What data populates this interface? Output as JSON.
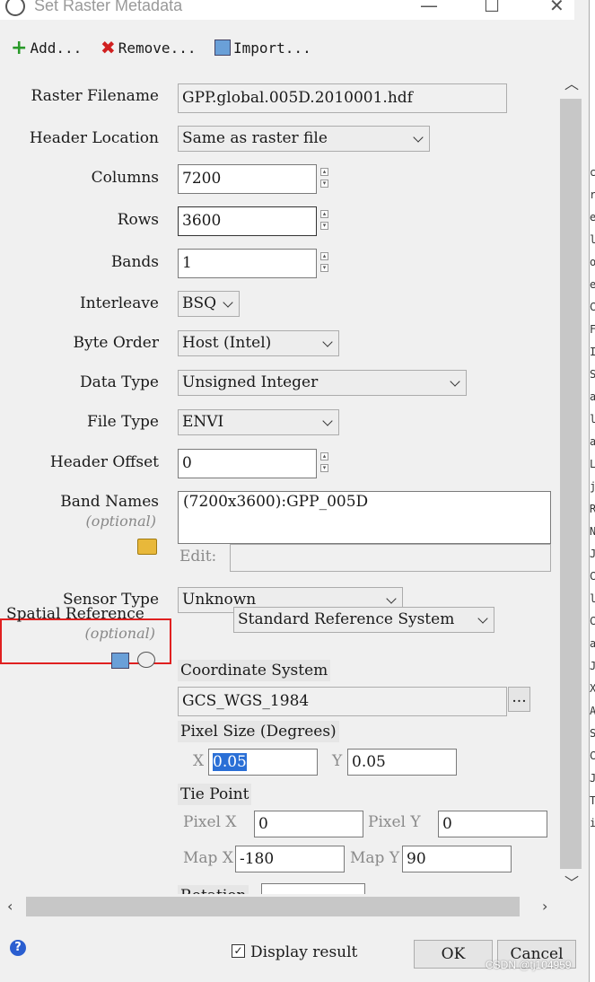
{
  "window": {
    "title": "Set Raster Metadata",
    "minimize": "—",
    "maximize": "☐",
    "close": "✕"
  },
  "toolbar": {
    "add": "Add...",
    "remove": "Remove...",
    "import": "Import..."
  },
  "form": {
    "raster_filename": {
      "label": "Raster Filename",
      "value": "GPP.global.005D.2010001.hdf"
    },
    "header_location": {
      "label": "Header Location",
      "value": "Same as raster file"
    },
    "columns": {
      "label": "Columns",
      "value": "7200"
    },
    "rows": {
      "label": "Rows",
      "value": "3600"
    },
    "bands": {
      "label": "Bands",
      "value": "1"
    },
    "interleave": {
      "label": "Interleave",
      "value": "BSQ"
    },
    "byte_order": {
      "label": "Byte Order",
      "value": "Host (Intel)"
    },
    "data_type": {
      "label": "Data Type",
      "value": "Unsigned Integer"
    },
    "file_type": {
      "label": "File Type",
      "value": "ENVI"
    },
    "header_offset": {
      "label": "Header Offset",
      "value": "0"
    },
    "band_names": {
      "label": "Band Names",
      "optional": "(optional)",
      "items": [
        "(7200x3600):GPP_005D"
      ],
      "edit_label": "Edit:",
      "edit_value": ""
    },
    "sensor_type": {
      "label": "Sensor Type",
      "value": "Unknown"
    },
    "spatial_reference": {
      "label": "Spatial Reference",
      "optional": "(optional)",
      "system": "Standard Reference System"
    },
    "coordinate_system": {
      "label": "Coordinate System",
      "value": "GCS_WGS_1984",
      "browse": "..."
    },
    "pixel_size": {
      "label": "Pixel Size (Degrees)",
      "x_label": "X",
      "x": "0.05",
      "y_label": "Y",
      "y": "0.05"
    },
    "tie_point": {
      "label": "Tie Point",
      "pixel_x_label": "Pixel X",
      "pixel_x": "0",
      "pixel_y_label": "Pixel Y",
      "pixel_y": "0",
      "map_x_label": "Map X",
      "map_x": "-180",
      "map_y_label": "Map Y",
      "map_y": "90"
    },
    "rotation": {
      "label": "Rotation"
    }
  },
  "footer": {
    "display_result": "Display result",
    "display_checked": true,
    "ok": "OK",
    "cancel": "Cancel",
    "help": "?"
  },
  "watermark": "CSDN @tj104959",
  "background_window_chars": [
    "c",
    "r",
    "e",
    "l",
    "o",
    "e",
    "C",
    "F",
    "I",
    "S",
    "a",
    "l",
    "a",
    "L",
    "j",
    "R",
    "N",
    "J",
    "C",
    "l",
    "C",
    "a",
    "J",
    "X",
    "A",
    "S",
    "C",
    "J",
    "T",
    "i"
  ]
}
